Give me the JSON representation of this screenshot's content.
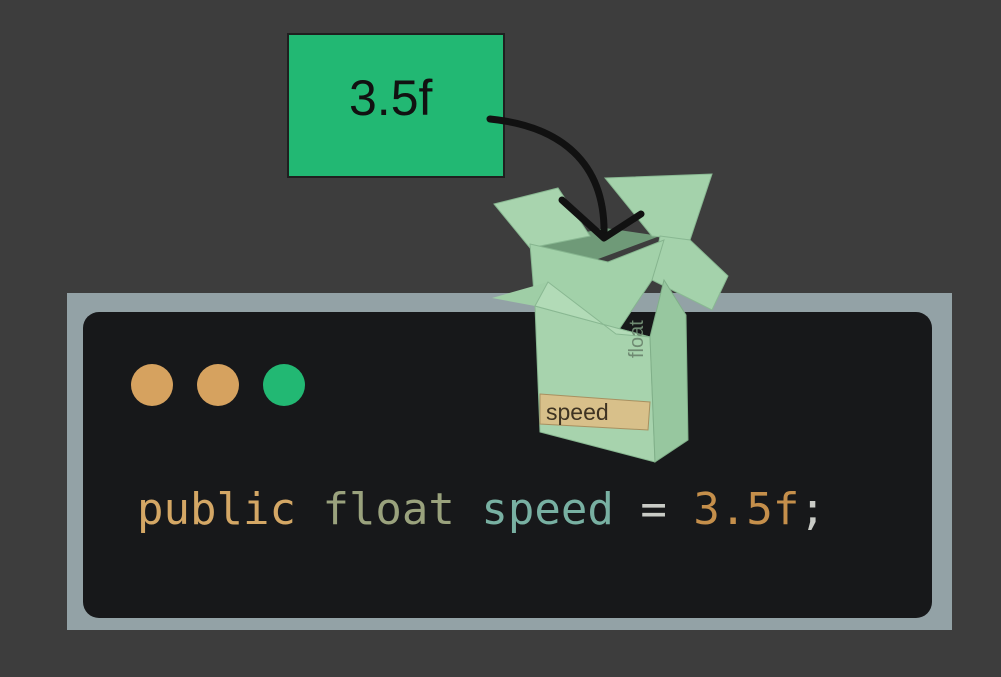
{
  "value_card": {
    "text": "3.5f",
    "color": "#22b873"
  },
  "code": {
    "keyword_public": "public",
    "type_float": "float",
    "name_speed": "speed",
    "op": "=",
    "value": "3.5f",
    "terminator": ";",
    "colors": {
      "keyword": "#d4a765",
      "type": "#9aa27d",
      "name": "#78b0a2",
      "op": "#c9cbc6",
      "value": "#c58f4b",
      "terminator": "#c9cbc6"
    }
  },
  "window_dots": {
    "colors": [
      "#d6a25f",
      "#d6a25f",
      "#22b873"
    ]
  },
  "box": {
    "side_label": "float",
    "name_tag": "speed",
    "fill": "#9fcea6",
    "tag_fill": "#d8c08a"
  }
}
